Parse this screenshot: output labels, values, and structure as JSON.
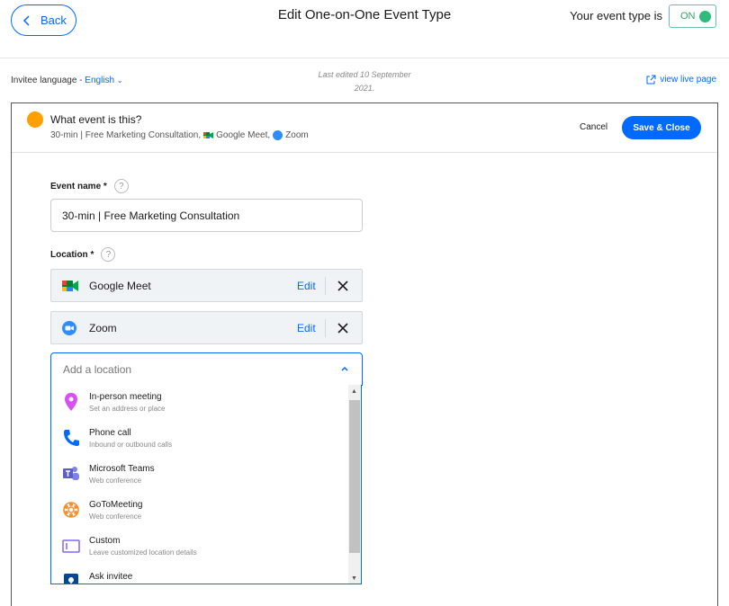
{
  "header": {
    "back_label": "Back",
    "title": "Edit One-on-One Event Type",
    "status_label": "Your event type is",
    "toggle_label": "ON"
  },
  "subbar": {
    "lang_label": "Invitee language -",
    "lang_value": "English",
    "edited_line1": "Last edited 10 September",
    "edited_line2": "2021.",
    "live_link": "view live page"
  },
  "panel": {
    "question": "What event is this?",
    "summary_text": "30-min | Free Marketing Consultation,",
    "summary_meet": "Google Meet,",
    "summary_zoom": "Zoom",
    "cancel_label": "Cancel",
    "save_label": "Save & Close",
    "dot_color": "#ff9f00"
  },
  "form": {
    "event_name_label": "Event name *",
    "event_name_value": "30-min | Free Marketing Consultation",
    "location_label": "Location *",
    "help_glyph": "?",
    "locations": [
      {
        "name": "Google Meet",
        "edit": "Edit",
        "icon": "google-meet-icon"
      },
      {
        "name": "Zoom",
        "edit": "Edit",
        "icon": "zoom-icon"
      }
    ],
    "add_location_placeholder": "Add a location"
  },
  "dropdown": {
    "options": [
      {
        "title": "In-person meeting",
        "desc": "Set an address or place",
        "icon": "map-pin-icon",
        "color": "#d84ff5"
      },
      {
        "title": "Phone call",
        "desc": "Inbound or outbound calls",
        "icon": "phone-icon",
        "color": "#0069ff"
      },
      {
        "title": "Microsoft Teams",
        "desc": "Web conference",
        "icon": "microsoft-teams-icon",
        "color": "#5b5fc7"
      },
      {
        "title": "GoToMeeting",
        "desc": "Web conference",
        "icon": "gotomeeting-icon",
        "color": "#f68d2e"
      },
      {
        "title": "Custom",
        "desc": "Leave customized location details",
        "icon": "custom-location-icon",
        "color": "#7b68ee"
      },
      {
        "title": "Ask invitee",
        "desc": "",
        "icon": "ask-invitee-icon",
        "color": "#004796"
      }
    ]
  },
  "colors": {
    "accent": "#0069ff",
    "toggle_on": "#2fbb7a"
  }
}
